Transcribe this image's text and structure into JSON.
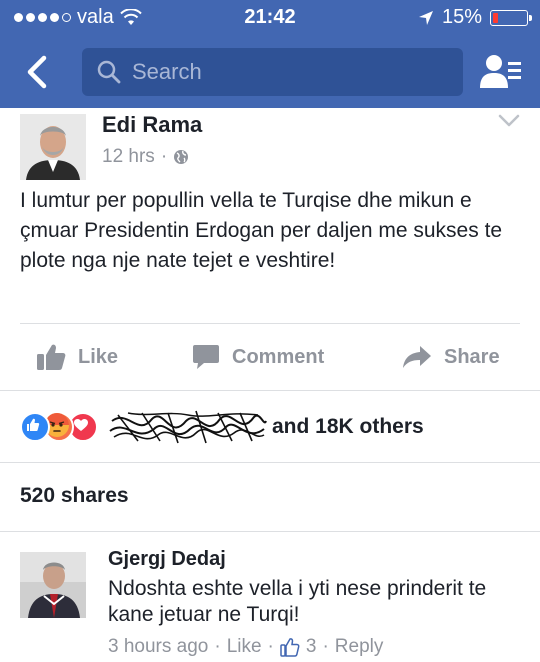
{
  "status_bar": {
    "carrier": "vala",
    "time": "21:42",
    "battery_percent": "15%",
    "battery_level": 0.15,
    "battery_color": "#ff3b30"
  },
  "nav": {
    "search_placeholder": "Search",
    "bar_color": "#4267b2"
  },
  "post": {
    "author": "Edi Rama",
    "time": "12 hrs",
    "separator": "·",
    "privacy_icon": "globe-icon",
    "text": "I lumtur per popullin vella te Turqise dhe mikun e çmuar Presidentin Erdogan per daljen me sukses te plote nga nje nate tejet e veshtire!",
    "actions": {
      "like": "Like",
      "comment": "Comment",
      "share": "Share"
    },
    "reactions": {
      "icons": [
        "like-reaction-icon",
        "angry-reaction-icon",
        "love-reaction-icon"
      ],
      "others_text": "and 18K others"
    },
    "shares_text": "520 shares"
  },
  "comment": {
    "author": "Gjergj Dedaj",
    "text": "Ndoshta eshte vella i yti nese prinderit te kane jetuar ne Turqi!",
    "time": "3 hours ago",
    "like_label": "Like",
    "like_count": "3",
    "reply_label": "Reply",
    "separator": "·"
  }
}
